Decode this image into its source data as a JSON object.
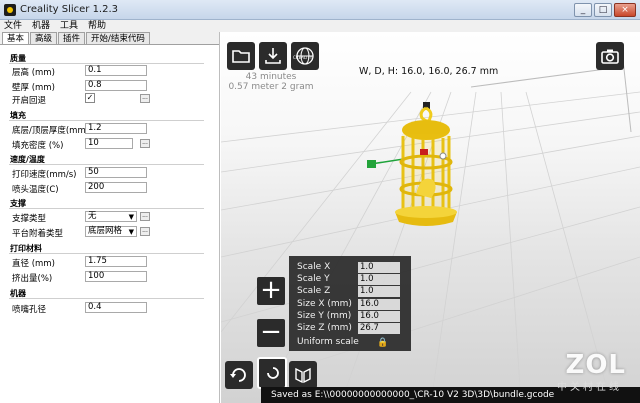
{
  "window": {
    "title": "Creality Slicer 1.2.3",
    "controls": [
      "_",
      "□",
      "×"
    ]
  },
  "menu": [
    "文件",
    "机器",
    "工具",
    "帮助"
  ],
  "tabs": [
    "基本",
    "高级",
    "插件",
    "开始/结束代码"
  ],
  "sections": {
    "quality": {
      "title": "质量",
      "layer_height": {
        "label": "层高 (mm)",
        "value": "0.1"
      },
      "shell": {
        "label": "壁厚 (mm)",
        "value": "0.8"
      },
      "retraction": {
        "label": "开启回退",
        "checked": "✓"
      }
    },
    "fill": {
      "title": "填充",
      "top_bottom": {
        "label": "底层/顶层厚度(mm)",
        "value": "1.2"
      },
      "density": {
        "label": "填充密度 (%)",
        "value": "10"
      }
    },
    "speed": {
      "title": "速度/温度",
      "print_speed": {
        "label": "打印速度(mm/s)",
        "value": "50"
      },
      "nozzle_temp": {
        "label": "喷头温度(C)",
        "value": "200"
      }
    },
    "support": {
      "title": "支撑",
      "type": {
        "label": "支撑类型",
        "value": "无"
      },
      "adhesion": {
        "label": "平台附着类型",
        "value": "底层网格"
      }
    },
    "filament": {
      "title": "打印材料",
      "diameter": {
        "label": "直径 (mm)",
        "value": "1.75"
      },
      "flow": {
        "label": "挤出量(%)",
        "value": "100"
      }
    },
    "machine": {
      "title": "机器",
      "nozzle": {
        "label": "喷嘴孔径",
        "value": "0.4"
      }
    }
  },
  "more_label": "...",
  "viewport": {
    "time": "43 minutes",
    "material": "0.57 meter 2 gram",
    "dimensions": "W, D, H: 16.0, 16.0, 26.7 mm",
    "scale": {
      "x": {
        "label": "Scale X",
        "value": "1.0"
      },
      "y": {
        "label": "Scale Y",
        "value": "1.0"
      },
      "z": {
        "label": "Scale Z",
        "value": "1.0"
      },
      "size_x": {
        "label": "Size X (mm)",
        "value": "16.0"
      },
      "size_y": {
        "label": "Size Y (mm)",
        "value": "16.0"
      },
      "size_z": {
        "label": "Size Z (mm)",
        "value": "26.7"
      },
      "uniform": "Uniform scale"
    },
    "status": "Saved as E:\\\\00000000000000_\\CR-10 V2 3D\\3D\\bundle.gcode",
    "watermark": "ZOL",
    "watermark_cn": "中关村在线",
    "logo_text": "CREALITY",
    "zoom_in": "+",
    "zoom_out": "−"
  },
  "colors": {
    "model": "#f0cc1d",
    "panel": "#2f2f2f",
    "accent_green": "#23a33a"
  }
}
